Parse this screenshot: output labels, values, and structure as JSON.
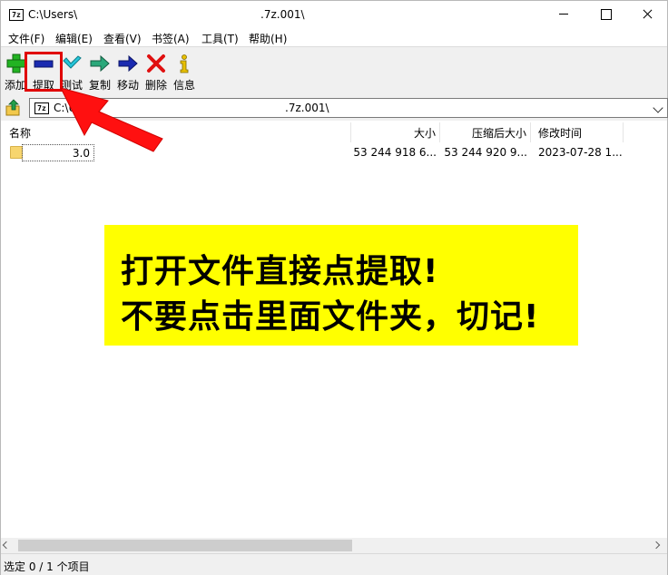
{
  "titlebar": {
    "path_prefix": "C:\\Users\\",
    "archive_name": ".7z.001\\",
    "app_icon_text": "7z"
  },
  "menu": [
    "文件(F)",
    "编辑(E)",
    "查看(V)",
    "书签(A)",
    "工具(T)",
    "帮助(H)"
  ],
  "toolbar": {
    "add": "添加",
    "extract": "提取",
    "test": "测试",
    "copy": "复制",
    "move": "移动",
    "delete": "删除",
    "info": "信息"
  },
  "address": {
    "prefix": "C:\\Us",
    "archive_name": ".7z.001\\"
  },
  "columns": {
    "name": "名称",
    "size": "大小",
    "packed_size": "压缩后大小",
    "modified": "修改时间"
  },
  "rows": [
    {
      "name": "3.0",
      "size": "53 244 918 6...",
      "packed_size": "53 244 920 9...",
      "modified": "2023-07-28 1..."
    }
  ],
  "banner": {
    "line1": "打开文件直接点提取!",
    "line2": "不要点击里面文件夹，切记!"
  },
  "status": {
    "text": "选定 0 / 1 个项目"
  },
  "colors": {
    "banner_bg": "#ffff00",
    "annotation_red": "#e00000"
  }
}
